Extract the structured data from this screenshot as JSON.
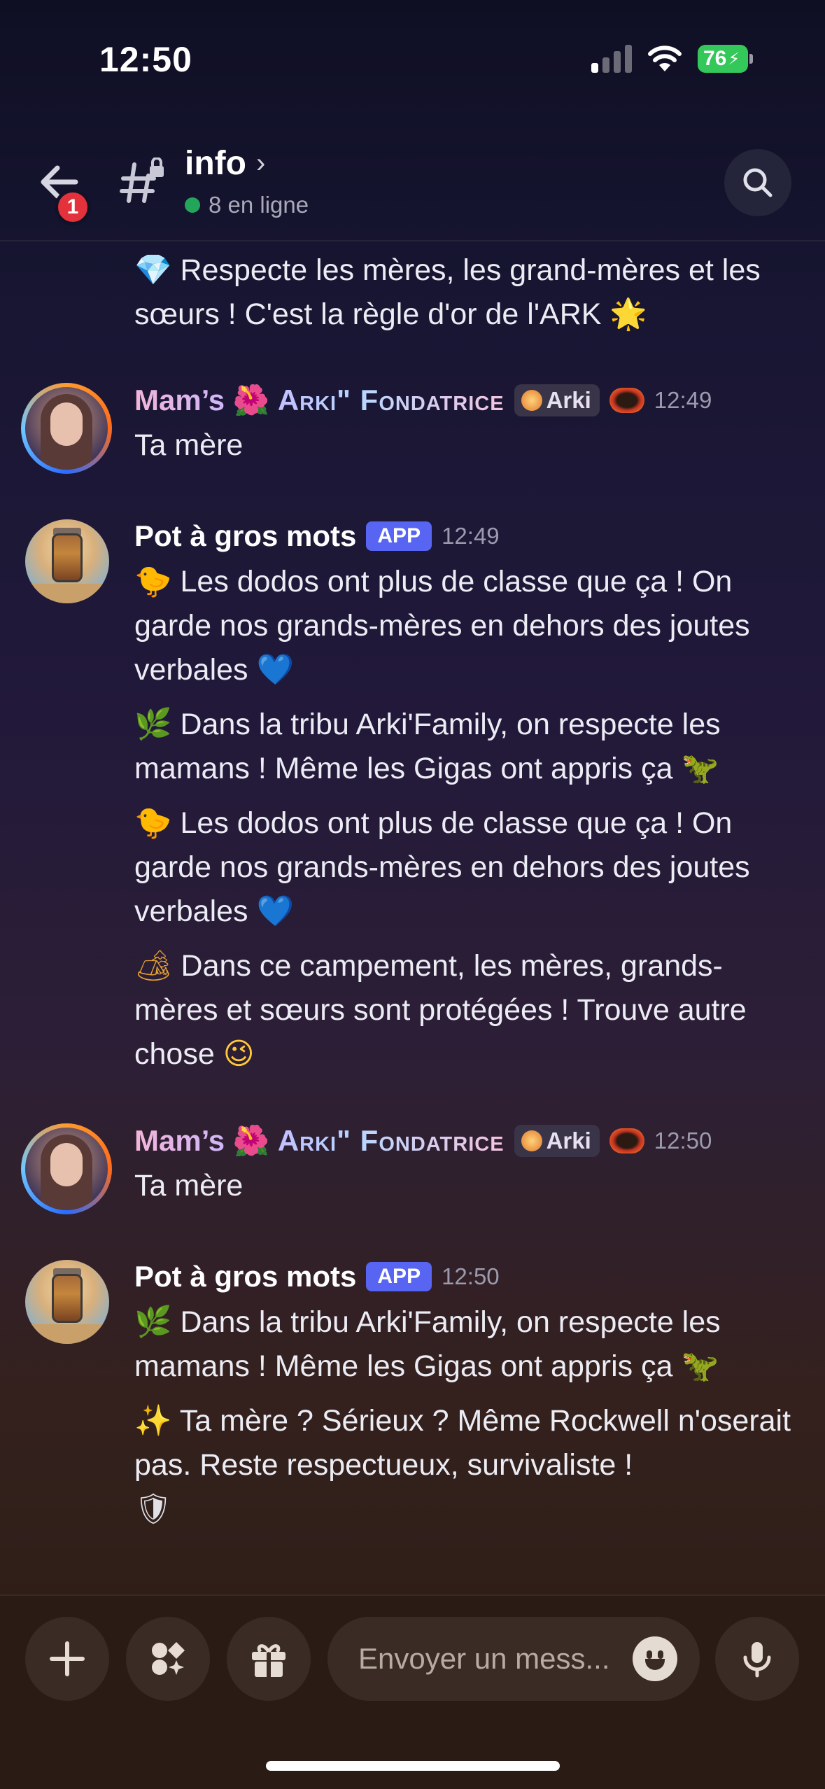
{
  "status_bar": {
    "time": "12:50",
    "battery": "76"
  },
  "header": {
    "back_badge": "1",
    "channel_name": "info",
    "online_text": "8 en ligne"
  },
  "messages": {
    "m0": {
      "gem": "💎",
      "text": " Respecte les mères, les grand-mères et les sœurs ! C'est la règle d'or de l'ARK ",
      "star": "🌟"
    },
    "m1": {
      "user_a": "Mam’s",
      "flower": "🌺",
      "user_b": "Arki\" Fondatrice",
      "tag": "Arki",
      "time": "12:49",
      "text": "Ta mère"
    },
    "m2": {
      "user": "Pot à gros mots",
      "app": "APP",
      "time": "12:49",
      "p1_emoji": "🐤",
      "p1": " Les dodos ont plus de classe que ça ! On garde nos grands-mères en dehors des joutes verbales ",
      "p1_end": "💙",
      "p2_emoji": "🌿",
      "p2": " Dans la tribu Arki'Family, on respecte les mamans ! Même les Gigas ont appris ça ",
      "p2_end": "🦖",
      "p3_emoji": "🐤",
      "p3": " Les dodos ont plus de classe que ça ! On garde nos grands-mères en dehors des joutes verbales ",
      "p3_end": "💙",
      "p4_emoji": "🏕",
      "p4": " Dans ce campement, les mères, grands-mères et sœurs sont protégées ! Trouve autre chose ",
      "p4_end": "😉"
    },
    "m3": {
      "user_a": "Mam’s",
      "flower": "🌺",
      "user_b": "Arki\" Fondatrice",
      "tag": "Arki",
      "time": "12:50",
      "text": "Ta mère"
    },
    "m4": {
      "user": "Pot à gros mots",
      "app": "APP",
      "time": "12:50",
      "p1_emoji": "🌿",
      "p1": " Dans la tribu Arki'Family, on respecte les mamans ! Même les Gigas ont appris ça ",
      "p1_end": "🦖",
      "p2_emoji": "✨",
      "p2": " Ta mère ? Sérieux ? Même Rockwell n'oserait pas. Reste respectueux, survivaliste !",
      "p2_end": "🛡"
    }
  },
  "composer": {
    "placeholder": "Envoyer un mess..."
  }
}
